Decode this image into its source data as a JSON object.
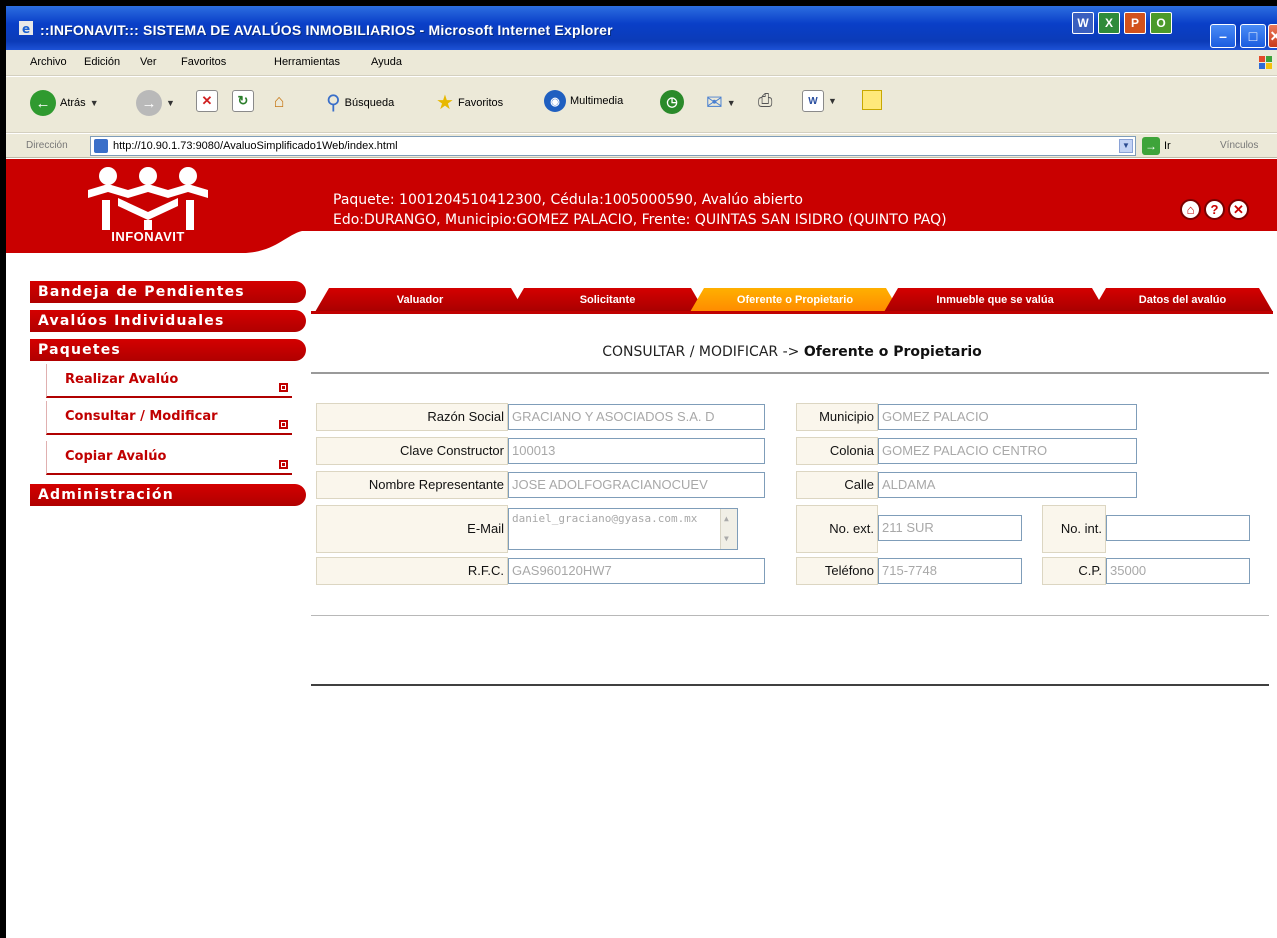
{
  "window": {
    "title": "::INFONAVIT::: SISTEMA DE AVALÚOS INMOBILIARIOS - Microsoft Internet Explorer",
    "app_icons": [
      "W",
      "X",
      "P",
      "O"
    ]
  },
  "menu": [
    "Archivo",
    "Edición",
    "Ver",
    "Favoritos",
    "Herramientas",
    "Ayuda"
  ],
  "toolbar": {
    "back": "Atrás",
    "search": "Búsqueda",
    "favorites": "Favoritos",
    "multimedia": "Multimedia"
  },
  "address": {
    "label": "Dirección",
    "url": "http://10.90.1.73:9080/AvaluoSimplificado1Web/index.html",
    "go": "Ir",
    "links": "Vínculos"
  },
  "header": {
    "logo_text": "INFONAVIT",
    "line1": "Paquete: 1001204510412300, Cédula:1005000590, Avalúo abierto",
    "line2": "Edo:DURANGO, Municipio:GOMEZ PALACIO, Frente: QUINTAS SAN ISIDRO (QUINTO PAQ)"
  },
  "sidebar": {
    "bandeja": "Bandeja de Pendientes",
    "individuales": "Avalúos Individuales",
    "paquetes": "Paquetes",
    "sub": [
      "Realizar Avalúo",
      "Consultar / Modificar",
      "Copiar Avalúo"
    ],
    "admin": "Administración"
  },
  "tabs": [
    "Valuador",
    "Solicitante",
    "Oferente o Propietario",
    "Inmueble que se valúa",
    "Datos del avalúo"
  ],
  "form": {
    "title_prefix": "CONSULTAR / MODIFICAR ->",
    "title_main": "Oferente o Propietario",
    "razon_social": {
      "label": "Razón Social",
      "value": "GRACIANO Y ASOCIADOS S.A. D"
    },
    "clave_constructor": {
      "label": "Clave Constructor",
      "value": "100013"
    },
    "nombre_representante": {
      "label": "Nombre Representante",
      "value": "JOSE ADOLFOGRACIANOCUEV"
    },
    "email": {
      "label": "E-Mail",
      "value": "daniel_graciano@gyasa.com.mx"
    },
    "rfc": {
      "label": "R.F.C.",
      "value": "GAS960120HW7"
    },
    "municipio": {
      "label": "Municipio",
      "value": "GOMEZ PALACIO"
    },
    "colonia": {
      "label": "Colonia",
      "value": "GOMEZ PALACIO CENTRO"
    },
    "calle": {
      "label": "Calle",
      "value": "ALDAMA"
    },
    "no_ext": {
      "label": "No. ext.",
      "value": "211 SUR"
    },
    "no_int": {
      "label": "No. int.",
      "value": ""
    },
    "telefono": {
      "label": "Teléfono",
      "value": "715-7748"
    },
    "cp": {
      "label": "C.P.",
      "value": "35000"
    }
  }
}
